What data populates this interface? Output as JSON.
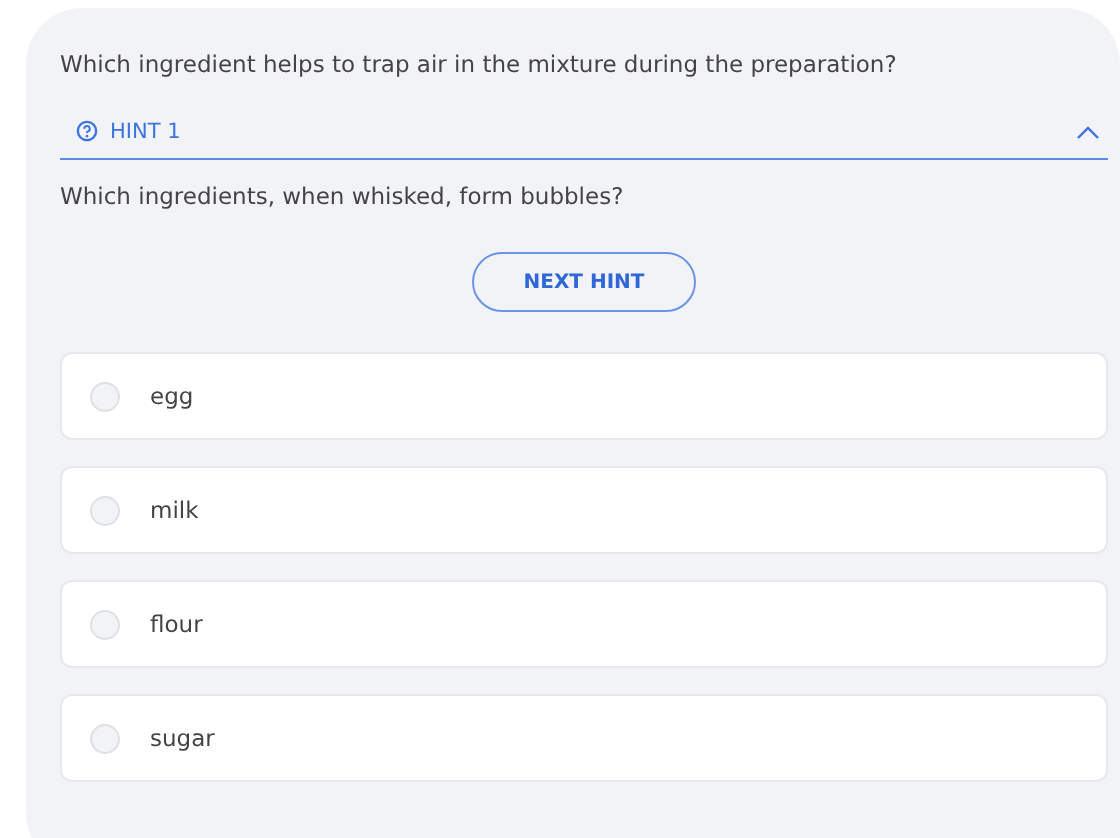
{
  "question": "Which ingredient helps to trap air in the mixture during the preparation?",
  "hint": {
    "label": "HINT 1",
    "expanded": true,
    "text": "Which ingredients, when whisked, form bubbles?"
  },
  "next_hint_button": "NEXT HINT",
  "options": [
    {
      "label": "egg",
      "selected": false
    },
    {
      "label": "milk",
      "selected": false
    },
    {
      "label": "flour",
      "selected": false
    },
    {
      "label": "sugar",
      "selected": false
    }
  ]
}
